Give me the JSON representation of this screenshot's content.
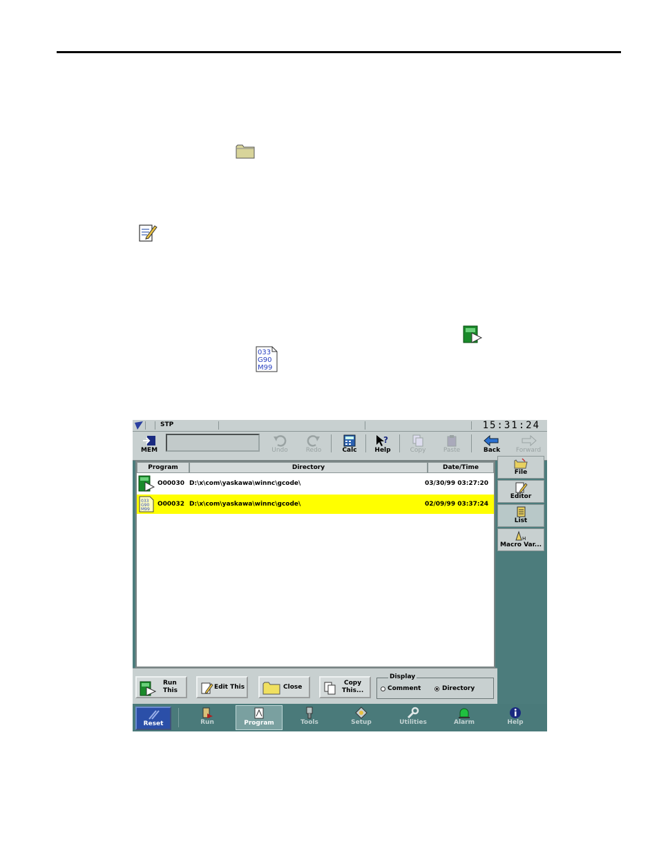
{
  "statusbar": {
    "mode": "STP",
    "clock": "15:31:24"
  },
  "toolbar": {
    "mem_label": "MEM",
    "undo_label": "Undo",
    "redo_label": "Redo",
    "calc_label": "Calc",
    "help_label": "Help",
    "copy_label": "Copy",
    "paste_label": "Paste",
    "back_label": "Back",
    "forward_label": "Forward"
  },
  "list": {
    "columns": [
      "Program",
      "Directory",
      "Date/Time"
    ],
    "rows": [
      {
        "program": "O00030",
        "directory": "D:\\x\\com\\yaskawa\\winnc\\gcode\\",
        "datetime": "03/30/99 03:27:20",
        "icon": "run-program-icon"
      },
      {
        "program": "O00032",
        "directory": "D:\\x\\com\\yaskawa\\winnc\\gcode\\",
        "datetime": "02/09/99 03:37:24",
        "icon": "gcode-file-icon"
      }
    ]
  },
  "side_tabs": [
    "File",
    "Editor",
    "List",
    "Macro Var..."
  ],
  "actions": {
    "run_line1": "Run",
    "run_line2": "This",
    "edit_label": "Edit This",
    "close_label": "Close",
    "copy_line1": "Copy",
    "copy_line2": "This...",
    "display_title": "Display",
    "comment_label": "Comment",
    "directory_label": "Directory"
  },
  "nav": {
    "reset": "Reset",
    "items": [
      "Run",
      "Program",
      "Tools",
      "Setup",
      "Utilities",
      "Alarm",
      "Help"
    ]
  },
  "colors": {
    "screen_bg": "#4c7c7c",
    "selected_row": "#ffff00",
    "reset_button": "#2b4fa8"
  }
}
